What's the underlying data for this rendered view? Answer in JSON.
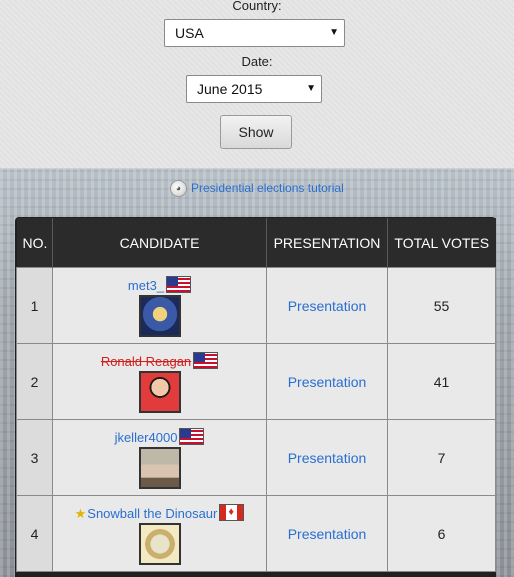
{
  "filters": {
    "country_label": "Country:",
    "country_value": "USA",
    "date_label": "Date:",
    "date_value": "June 2015",
    "show_label": "Show"
  },
  "tutorial": {
    "icon": "tutorial-icon",
    "link": "Presidential elections tutorial"
  },
  "table": {
    "headers": [
      "NO.",
      "CANDIDATE",
      "PRESENTATION",
      "TOTAL VOTES"
    ],
    "rows": [
      {
        "no": "1",
        "name": "met3_",
        "flag": "us-flag",
        "presentation": "Presentation",
        "votes": "55"
      },
      {
        "no": "2",
        "name": "Ronald Reagan",
        "flag": "us-flag",
        "presentation": "Presentation",
        "votes": "41"
      },
      {
        "no": "3",
        "name": "jkeller4000",
        "flag": "us-flag",
        "presentation": "Presentation",
        "votes": "7"
      },
      {
        "no": "4",
        "name": "Snowball the Dinosaur",
        "flag": "canada-flag",
        "presentation": "Presentation",
        "votes": "6"
      }
    ]
  },
  "colors": {
    "link": "#2a6fd0",
    "strike_name": "#d02020",
    "header_bg": "#2b2b2b"
  }
}
